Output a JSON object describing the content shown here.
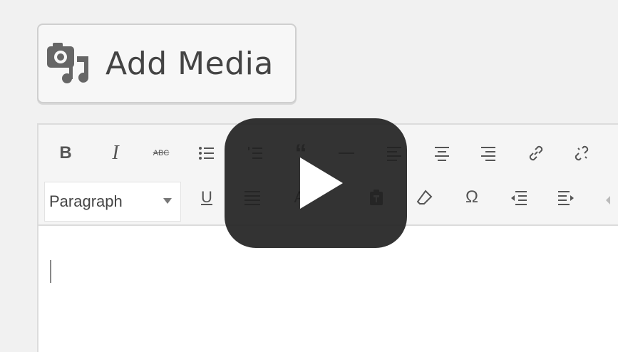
{
  "add_media": {
    "label": "Add Media",
    "icon": "camera-music-icon"
  },
  "toolbar": {
    "row1": [
      {
        "name": "bold",
        "glyph": "B"
      },
      {
        "name": "italic",
        "glyph": "I"
      },
      {
        "name": "strikethrough",
        "glyph": "ABC"
      },
      {
        "name": "bullet-list",
        "glyph": "bullets"
      },
      {
        "name": "numbered-list",
        "glyph": "numbers"
      },
      {
        "name": "blockquote",
        "glyph": "“"
      },
      {
        "name": "horizontal-line",
        "glyph": "—"
      },
      {
        "name": "align-left",
        "glyph": "align-left"
      },
      {
        "name": "align-center",
        "glyph": "align-center"
      },
      {
        "name": "align-right",
        "glyph": "align-right"
      },
      {
        "name": "insert-link",
        "glyph": "link"
      },
      {
        "name": "remove-link",
        "glyph": "unlink"
      }
    ],
    "row2": {
      "format_select": "Paragraph",
      "buttons": [
        {
          "name": "underline",
          "glyph": "U"
        },
        {
          "name": "justify",
          "glyph": "justify"
        },
        {
          "name": "text-color",
          "glyph": "A"
        },
        {
          "name": "paste-as-text",
          "glyph": "paste"
        },
        {
          "name": "clear-formatting",
          "glyph": "eraser"
        },
        {
          "name": "special-character",
          "glyph": "Ω"
        },
        {
          "name": "decrease-indent",
          "glyph": "outdent"
        },
        {
          "name": "increase-indent",
          "glyph": "indent"
        }
      ]
    }
  },
  "video_overlay": {
    "icon": "play-icon"
  }
}
